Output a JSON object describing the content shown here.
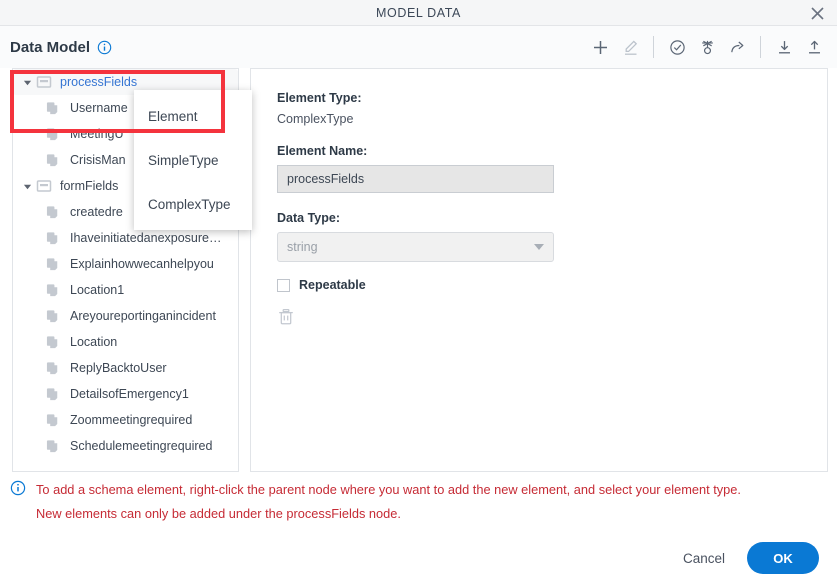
{
  "window": {
    "title": "MODEL DATA",
    "close_icon": "close-icon"
  },
  "header": {
    "title": "Data Model",
    "info_icon": "info-circle-icon"
  },
  "toolbar": {
    "items": [
      {
        "name": "add-element-button",
        "icon": "plus-icon",
        "disabled": false
      },
      {
        "name": "edit-element-button",
        "icon": "pencil-icon",
        "disabled": true
      },
      {
        "name": "validate-button",
        "icon": "check-circle-icon",
        "disabled": false
      },
      {
        "name": "test-button",
        "icon": "node-burst-icon",
        "disabled": false
      },
      {
        "name": "share-button",
        "icon": "share-arrow-icon",
        "disabled": false
      },
      {
        "name": "download-button",
        "icon": "download-icon",
        "disabled": false
      },
      {
        "name": "upload-button",
        "icon": "upload-icon",
        "disabled": false
      }
    ]
  },
  "tree": {
    "nodes": [
      {
        "label": "processFields",
        "type": "parent",
        "expanded": true,
        "selected": true,
        "icon": "complex-type-icon"
      },
      {
        "label": "Username",
        "type": "child",
        "icon": "element-icon"
      },
      {
        "label": "MeetingU",
        "type": "child",
        "icon": "element-icon"
      },
      {
        "label": "CrisisMan",
        "type": "child",
        "icon": "element-icon"
      },
      {
        "label": "formFields",
        "type": "parent",
        "expanded": true,
        "selected": false,
        "icon": "complex-type-icon"
      },
      {
        "label": "createdre",
        "type": "child",
        "icon": "element-icon"
      },
      {
        "label": "Ihaveinitiatedanexposure…",
        "type": "child",
        "icon": "element-icon"
      },
      {
        "label": "Explainhowwecanhelpyou",
        "type": "child",
        "icon": "element-icon"
      },
      {
        "label": "Location1",
        "type": "child",
        "icon": "element-icon"
      },
      {
        "label": "Areyoureportinganincident",
        "type": "child",
        "icon": "element-icon"
      },
      {
        "label": "Location",
        "type": "child",
        "icon": "element-icon"
      },
      {
        "label": "ReplyBacktoUser",
        "type": "child",
        "icon": "element-icon"
      },
      {
        "label": "DetailsofEmergency1",
        "type": "child",
        "icon": "element-icon"
      },
      {
        "label": "Zoommeetingrequired",
        "type": "child",
        "icon": "element-icon"
      },
      {
        "label": "Schedulemeetingrequired",
        "type": "child",
        "icon": "element-icon"
      }
    ]
  },
  "context_menu": {
    "items": [
      {
        "label": "Element"
      },
      {
        "label": "SimpleType"
      },
      {
        "label": "ComplexType"
      }
    ]
  },
  "detail": {
    "element_type_label": "Element Type:",
    "element_type_value": "ComplexType",
    "element_name_label": "Element Name:",
    "element_name_value": "processFields",
    "element_name_placeholder": "Element Name",
    "data_type_label": "Data Type:",
    "data_type_value": "string",
    "data_type_options": [
      "string"
    ],
    "repeatable_label": "Repeatable",
    "repeatable_checked": false,
    "delete_icon": "trash-icon"
  },
  "message": {
    "icon": "info-circle-icon",
    "line1": "To add a schema element, right-click the parent node where you want to add the new element, and select your element type.",
    "line2": "New elements can only be added under the processFields node."
  },
  "footer": {
    "cancel_label": "Cancel",
    "ok_label": "OK"
  },
  "colors": {
    "accent": "#0a79d4",
    "annotation": "#f4333d",
    "message_text": "#c62b35",
    "tree_parent_label": "#3575d3"
  }
}
